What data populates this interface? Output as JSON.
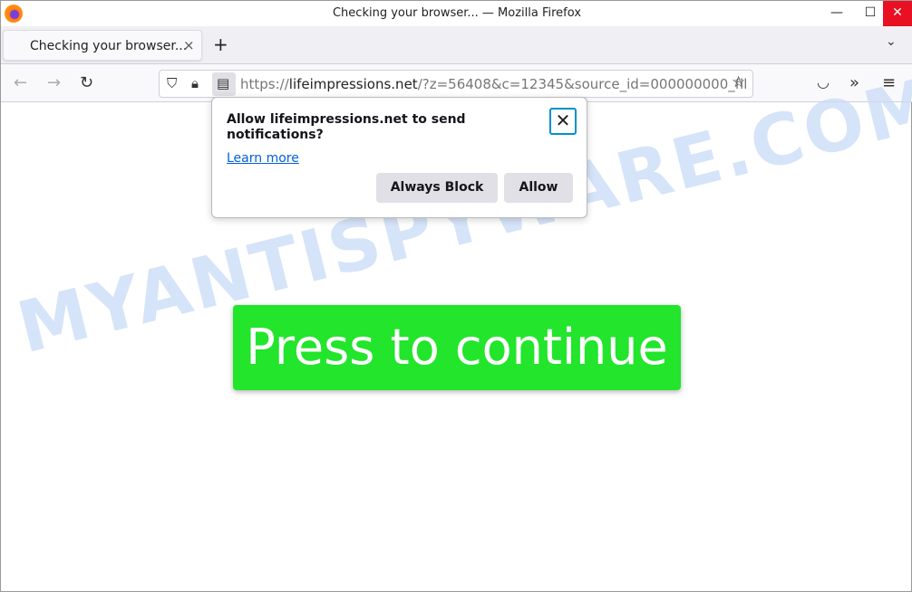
{
  "window": {
    "title": "Checking your browser... — Mozilla Firefox",
    "minimize": "—",
    "maximize": "☐",
    "close": "✕"
  },
  "tabs": [
    {
      "label": "Checking your browser...",
      "close": "×"
    }
  ],
  "tabstrip": {
    "new_tab": "+",
    "list_all": "⌄"
  },
  "nav": {
    "back": "←",
    "forward": "→",
    "reload": "↻",
    "url_scheme": "https://",
    "url_host": "lifeimpressions.net",
    "url_rest": "/?z=56408&c=12345&source_id=000000000_fil",
    "bookmark": "☆",
    "pocket": "◡",
    "overflow": "»",
    "menu": "≡"
  },
  "popup": {
    "message": "Allow lifeimpressions.net to send notifications?",
    "learn_more": "Learn more",
    "close": "✕",
    "block": "Always Block",
    "allow": "Allow"
  },
  "page": {
    "button": "Press to continue",
    "watermark": "MYANTISPYWARE.COM",
    "button_color": "#22e52c"
  }
}
